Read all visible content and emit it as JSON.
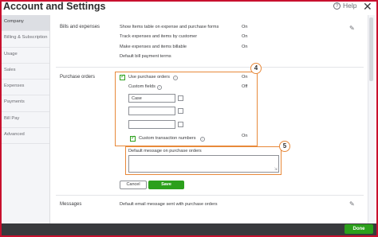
{
  "window": {
    "title": "Account and Settings",
    "help_label": "Help",
    "help_icon": "?",
    "close_icon": "✕"
  },
  "sidebar": {
    "items": [
      {
        "label": "Company"
      },
      {
        "label": "Billing & Subscription"
      },
      {
        "label": "Usage"
      },
      {
        "label": "Sales"
      },
      {
        "label": "Expenses"
      },
      {
        "label": "Payments"
      },
      {
        "label": "Bill Pay"
      },
      {
        "label": "Advanced"
      }
    ]
  },
  "bills_section": {
    "label": "Bills and expenses",
    "rows": [
      {
        "text": "Show Items table on expense and purchase forms",
        "value": "On"
      },
      {
        "text": "Track expenses and items by customer",
        "value": "On"
      },
      {
        "text": "Make expenses and items billable",
        "value": "On"
      },
      {
        "text": "Default bill payment terms",
        "value": ""
      }
    ]
  },
  "purchase_orders": {
    "label": "Purchase orders",
    "badge_4": "4",
    "badge_5": "5",
    "use_po": {
      "label": "Use purchase orders",
      "value": "On",
      "checked": true
    },
    "custom_fields": {
      "label": "Custom fields",
      "value": "Off"
    },
    "fields": [
      {
        "value": "Case"
      },
      {
        "value": ""
      },
      {
        "value": ""
      }
    ],
    "custom_txn": {
      "label": "Custom transaction numbers",
      "value": "On",
      "checked": true
    },
    "default_message": {
      "label": "Default message on purchase orders",
      "value": ""
    },
    "cancel_label": "Cancel",
    "save_label": "Save"
  },
  "messages_section": {
    "label": "Messages",
    "row_text": "Default email message sent with purchase orders"
  },
  "footer": {
    "done_label": "Done"
  },
  "colors": {
    "accent_green": "#2ca01c",
    "highlight_orange": "#e8893a",
    "frame_red": "#c8102e",
    "footer_dark": "#393a3d"
  },
  "icons": [
    "help-icon",
    "close-icon",
    "pencil-icon",
    "info-icon",
    "checkmark-icon",
    "resize-handle-icon"
  ]
}
